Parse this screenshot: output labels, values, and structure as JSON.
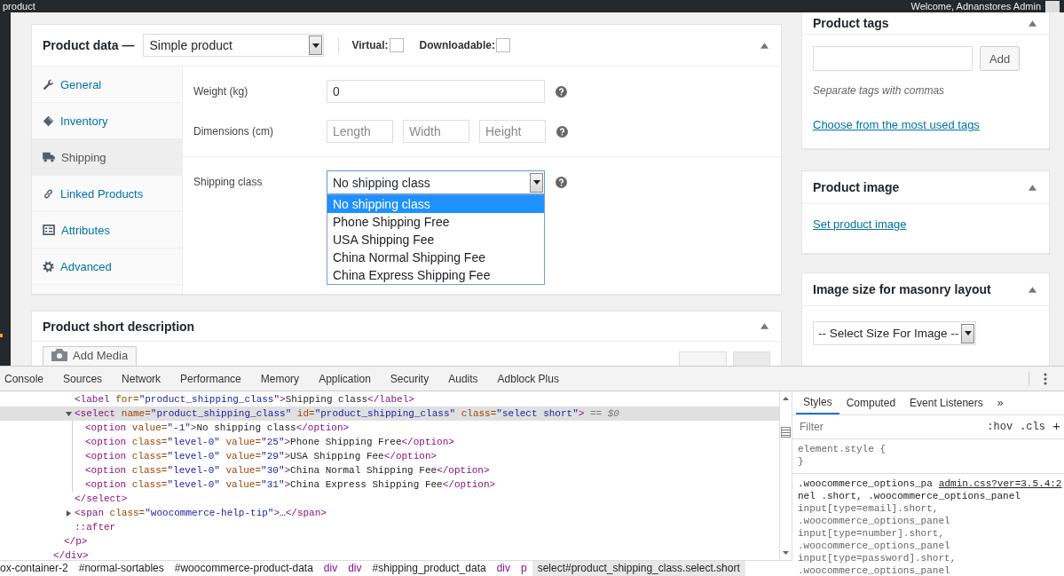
{
  "admin_bar": {
    "site": "product",
    "greeting": "Welcome, Adnanstores Admin"
  },
  "product_data": {
    "title": "Product data —",
    "type_select": "Simple product",
    "virtual": {
      "label": "Virtual:",
      "checked": false
    },
    "downloadable": {
      "label": "Downloadable:",
      "checked": false
    },
    "tabs": [
      {
        "label": "General",
        "selected": false
      },
      {
        "label": "Inventory",
        "selected": false
      },
      {
        "label": "Shipping",
        "selected": true
      },
      {
        "label": "Linked Products",
        "selected": false
      },
      {
        "label": "Attributes",
        "selected": false
      },
      {
        "label": "Advanced",
        "selected": false
      }
    ],
    "weight": {
      "label": "Weight (kg)",
      "value": "0"
    },
    "dimensions": {
      "label": "Dimensions (cm)",
      "placeholders": [
        "Length",
        "Width",
        "Height"
      ]
    },
    "shipping_class": {
      "label": "Shipping class",
      "value": "No shipping class",
      "open": true,
      "options": [
        {
          "label": "No shipping class",
          "selected": true
        },
        {
          "label": "Phone Shipping Free",
          "selected": false
        },
        {
          "label": "USA Shipping Fee",
          "selected": false
        },
        {
          "label": "China Normal Shipping Fee",
          "selected": false
        },
        {
          "label": "China Express Shipping Fee",
          "selected": false
        }
      ]
    }
  },
  "short_description": {
    "title": "Product short description",
    "add_media": "Add Media"
  },
  "sidebar": {
    "tags": {
      "title": "Product tags",
      "add_button": "Add",
      "hint": "Separate tags with commas",
      "link": "Choose from the most used tags"
    },
    "image": {
      "title": "Product image",
      "link": "Set product image"
    },
    "image_size": {
      "title": "Image size for masonry layout",
      "select": "-- Select Size For Image --"
    }
  },
  "devtools": {
    "tabs": [
      "Console",
      "Sources",
      "Network",
      "Performance",
      "Memory",
      "Application",
      "Security",
      "Audits",
      "Adblock Plus"
    ],
    "dom_tree": [
      {
        "closing": [
          {
            "kind": "tag",
            "text": "</div>"
          }
        ],
        "children": [
          {
            "closing": [
              {
                "kind": "tag",
                "text": "</p>"
              }
            ],
            "children": [
              {
                "selected": false,
                "tokens": [
                  {
                    "kind": "tag",
                    "text": "<label"
                  },
                  {
                    "kind": "attr",
                    "text": " for="
                  },
                  {
                    "kind": "val",
                    "text": "\"product_shipping_class\""
                  },
                  {
                    "kind": "tag",
                    "text": ">"
                  },
                  {
                    "kind": "text",
                    "text": "Shipping class"
                  },
                  {
                    "kind": "tag",
                    "text": "</label>"
                  }
                ]
              },
              {
                "selected": true,
                "expanded": true,
                "tokens": [
                  {
                    "kind": "tag",
                    "text": "<select"
                  },
                  {
                    "kind": "attr",
                    "text": " name="
                  },
                  {
                    "kind": "val",
                    "text": "\"product_shipping_class\""
                  },
                  {
                    "kind": "attr",
                    "text": " id="
                  },
                  {
                    "kind": "val",
                    "text": "\"product_shipping_class\""
                  },
                  {
                    "kind": "attr",
                    "text": " class="
                  },
                  {
                    "kind": "val",
                    "text": "\"select short\""
                  },
                  {
                    "kind": "tag",
                    "text": ">"
                  },
                  {
                    "kind": "note",
                    "text": " == $0"
                  }
                ],
                "closing": [
                  {
                    "kind": "tag",
                    "text": "</select>"
                  }
                ],
                "children": [
                  {
                    "selected": false,
                    "tokens": [
                      {
                        "kind": "tag",
                        "text": "<option"
                      },
                      {
                        "kind": "attr",
                        "text": " value="
                      },
                      {
                        "kind": "val",
                        "text": "\"-1\""
                      },
                      {
                        "kind": "tag",
                        "text": ">"
                      },
                      {
                        "kind": "text",
                        "text": "No shipping class"
                      },
                      {
                        "kind": "tag",
                        "text": "</option>"
                      }
                    ]
                  },
                  {
                    "selected": false,
                    "tokens": [
                      {
                        "kind": "tag",
                        "text": "<option"
                      },
                      {
                        "kind": "attr",
                        "text": " class="
                      },
                      {
                        "kind": "val",
                        "text": "\"level-0\""
                      },
                      {
                        "kind": "attr",
                        "text": " value="
                      },
                      {
                        "kind": "val",
                        "text": "\"25\""
                      },
                      {
                        "kind": "tag",
                        "text": ">"
                      },
                      {
                        "kind": "text",
                        "text": "Phone Shipping Free"
                      },
                      {
                        "kind": "tag",
                        "text": "</option>"
                      }
                    ]
                  },
                  {
                    "selected": false,
                    "tokens": [
                      {
                        "kind": "tag",
                        "text": "<option"
                      },
                      {
                        "kind": "attr",
                        "text": " class="
                      },
                      {
                        "kind": "val",
                        "text": "\"level-0\""
                      },
                      {
                        "kind": "attr",
                        "text": " value="
                      },
                      {
                        "kind": "val",
                        "text": "\"29\""
                      },
                      {
                        "kind": "tag",
                        "text": ">"
                      },
                      {
                        "kind": "text",
                        "text": "USA Shipping Fee"
                      },
                      {
                        "kind": "tag",
                        "text": "</option>"
                      }
                    ]
                  },
                  {
                    "selected": false,
                    "tokens": [
                      {
                        "kind": "tag",
                        "text": "<option"
                      },
                      {
                        "kind": "attr",
                        "text": " class="
                      },
                      {
                        "kind": "val",
                        "text": "\"level-0\""
                      },
                      {
                        "kind": "attr",
                        "text": " value="
                      },
                      {
                        "kind": "val",
                        "text": "\"30\""
                      },
                      {
                        "kind": "tag",
                        "text": ">"
                      },
                      {
                        "kind": "text",
                        "text": "China Normal Shipping Fee"
                      },
                      {
                        "kind": "tag",
                        "text": "</option>"
                      }
                    ]
                  },
                  {
                    "selected": false,
                    "tokens": [
                      {
                        "kind": "tag",
                        "text": "<option"
                      },
                      {
                        "kind": "attr",
                        "text": " class="
                      },
                      {
                        "kind": "val",
                        "text": "\"level-0\""
                      },
                      {
                        "kind": "attr",
                        "text": " value="
                      },
                      {
                        "kind": "val",
                        "text": "\"31\""
                      },
                      {
                        "kind": "tag",
                        "text": ">"
                      },
                      {
                        "kind": "text",
                        "text": "China Express Shipping Fee"
                      },
                      {
                        "kind": "tag",
                        "text": "</option>"
                      }
                    ]
                  }
                ]
              },
              {
                "selected": false,
                "expanded": false,
                "tokens": [
                  {
                    "kind": "tag",
                    "text": "<span"
                  },
                  {
                    "kind": "attr",
                    "text": " class="
                  },
                  {
                    "kind": "val",
                    "text": "\"woocommerce-help-tip\""
                  },
                  {
                    "kind": "tag",
                    "text": ">"
                  },
                  {
                    "kind": "text",
                    "text": "…"
                  },
                  {
                    "kind": "tag",
                    "text": "</span>"
                  }
                ]
              },
              {
                "selected": false,
                "tokens": [
                  {
                    "kind": "pseudo",
                    "text": "::after"
                  }
                ]
              }
            ]
          }
        ]
      }
    ],
    "breadcrumb": [
      {
        "text": "ox-container-2",
        "kind": "id",
        "selected": false
      },
      {
        "text": "#normal-sortables",
        "kind": "id",
        "selected": false
      },
      {
        "text": "#woocommerce-product-data",
        "kind": "id",
        "selected": false
      },
      {
        "text": "div",
        "kind": "tag",
        "selected": false
      },
      {
        "text": "div",
        "kind": "tag",
        "selected": false
      },
      {
        "text": "#shipping_product_data",
        "kind": "id",
        "selected": false
      },
      {
        "text": "div",
        "kind": "tag",
        "selected": false
      },
      {
        "text": "p",
        "kind": "tag",
        "selected": false
      },
      {
        "text": "select#product_shipping_class.select.short",
        "kind": "id",
        "selected": true
      }
    ],
    "styles": {
      "tabs": [
        {
          "label": "Styles",
          "selected": true
        },
        {
          "label": "Computed",
          "selected": false
        },
        {
          "label": "Event Listeners",
          "selected": false
        },
        {
          "label": "»",
          "selected": false
        }
      ],
      "filter_placeholder": "Filter",
      "hov": ":hov",
      "cls": ".cls",
      "add": "+",
      "element_style": [
        "element.style {",
        "}"
      ],
      "rule_first": ".woocommerce_options_pa",
      "rule_source": "admin.css?ver=3.5.4:2",
      "rule_lines": [
        "nel .short, .woocommerce_options_panel",
        "input[type=email].short,",
        ".woocommerce_options_panel",
        "input[type=number].short,",
        ".woocommerce_options_panel",
        "input[type=password].short,",
        ".woocommerce_options_panel"
      ]
    }
  }
}
